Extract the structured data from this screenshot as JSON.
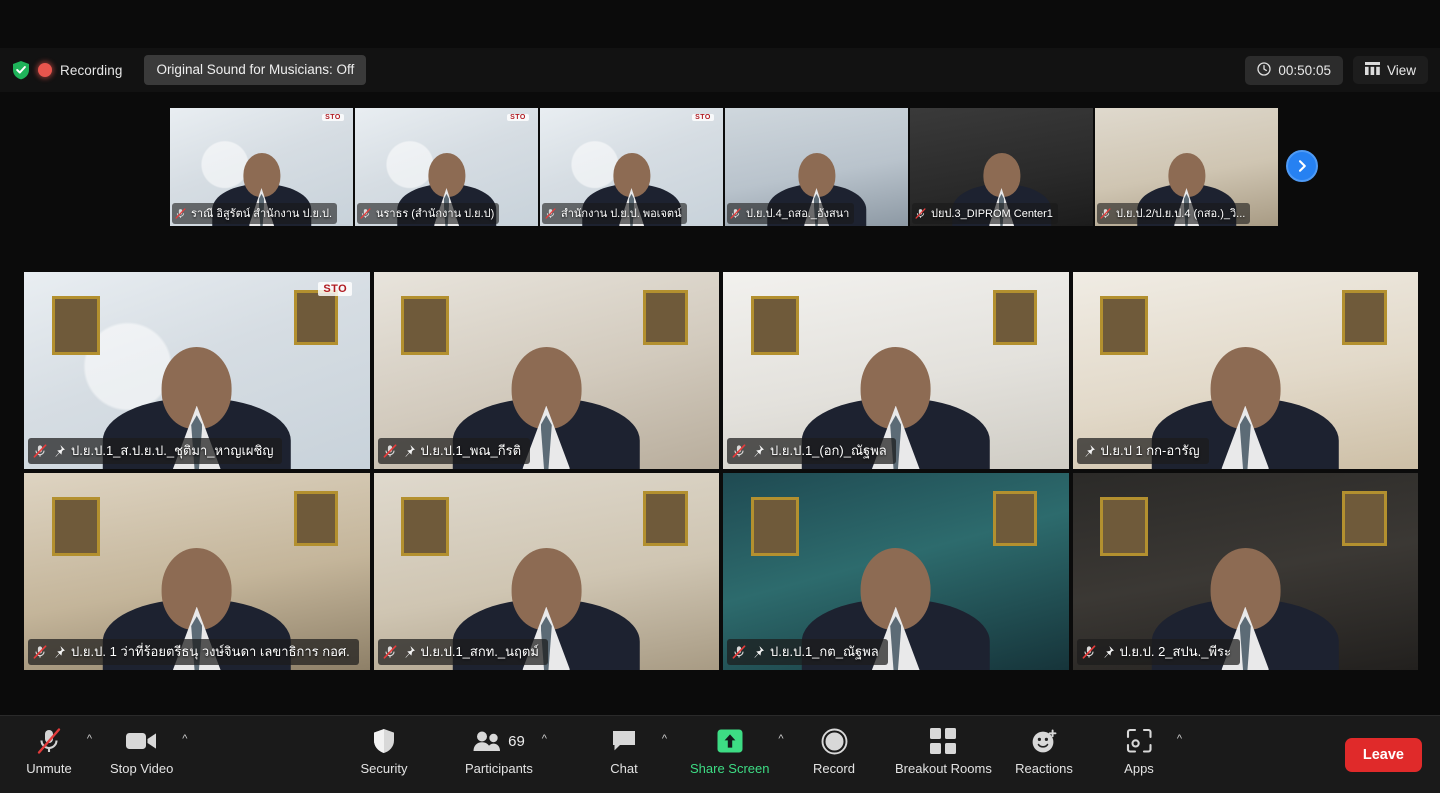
{
  "app": {
    "name": "Zoom Meeting"
  },
  "header": {
    "security_shield_icon": "shield-check-icon",
    "recording_icon": "recording-dot-icon",
    "recording_label": "Recording",
    "original_sound_label": "Original Sound for Musicians: Off",
    "timer_icon": "clock-icon",
    "timer_value": "00:50:05",
    "view_icon": "grid-view-icon",
    "view_label": "View"
  },
  "filmstrip": {
    "next_arrow_icon": "chevron-right-icon",
    "thumbnails": [
      {
        "name": "ราณี อิสูรัตน์ สำนักงาน ป.ย.ป.",
        "muted": true,
        "pinned": false,
        "bg": "bg-sto",
        "logo": "STO"
      },
      {
        "name": "นราธร (สำนักงาน ป.ย.ป)",
        "muted": true,
        "pinned": false,
        "bg": "bg-sto",
        "logo": "STO"
      },
      {
        "name": "สำนักงาน ป.ย.ป. พอเจตน์",
        "muted": true,
        "pinned": false,
        "bg": "bg-sto",
        "logo": "STO"
      },
      {
        "name": "ป.ย.ป.4_ถสอ._อังสนา",
        "muted": true,
        "pinned": false,
        "bg": "bg-bluish",
        "logo": ""
      },
      {
        "name": "ปยป.3_DIPROM Center1",
        "muted": true,
        "pinned": false,
        "bg": "bg-gray",
        "logo": ""
      },
      {
        "name": "ป.ย.ป.2/ป.ย.ป.4 (กสอ.)_วิ...",
        "muted": true,
        "pinned": false,
        "bg": "bg-office",
        "logo": ""
      }
    ]
  },
  "gallery": {
    "tiles": [
      {
        "name": "ป.ย.ป.1_ส.ป.ย.ป._ชุติมา_หาญเผชิญ",
        "muted": true,
        "pinned": true,
        "active": false,
        "bg": "bg-sto",
        "logo": "STO"
      },
      {
        "name": "ป.ย.ป.1_พณ_กีรติ",
        "muted": true,
        "pinned": true,
        "active": false,
        "bg": "bg-room-a",
        "logo": ""
      },
      {
        "name": "ป.ย.ป.1_(อก)_ณัฐพล",
        "muted": true,
        "pinned": true,
        "active": false,
        "bg": "bg-white",
        "logo": ""
      },
      {
        "name": "ป.ย.ป 1 กก-อารัญ",
        "muted": false,
        "pinned": true,
        "active": true,
        "bg": "bg-room-c",
        "logo": ""
      },
      {
        "name": "ป.ย.ป. 1 ว่าที่ร้อยตรีธนุ วงษ์จินดา เลขาธิการ กอศ.",
        "muted": true,
        "pinned": true,
        "active": false,
        "bg": "bg-warm",
        "logo": ""
      },
      {
        "name": "ป.ย.ป.1_สกท._นฤตม์",
        "muted": true,
        "pinned": true,
        "active": false,
        "bg": "bg-office",
        "logo": ""
      },
      {
        "name": "ป.ย.ป.1_กต_ณัฐพล",
        "muted": true,
        "pinned": true,
        "active": false,
        "bg": "bg-teal",
        "logo": ""
      },
      {
        "name": "ป.ย.ป. 2_สปน._พีระ",
        "muted": true,
        "pinned": true,
        "active": false,
        "bg": "bg-dark-a",
        "logo": ""
      }
    ]
  },
  "toolbar": {
    "items": [
      {
        "id": "mute",
        "icon": "microphone-muted-icon",
        "label": "Unmute",
        "caret": true,
        "green": false,
        "count": ""
      },
      {
        "id": "video",
        "icon": "video-camera-icon",
        "label": "Stop Video",
        "caret": true,
        "green": false,
        "count": ""
      },
      {
        "id": "security",
        "icon": "shield-icon",
        "label": "Security",
        "caret": false,
        "green": false,
        "count": ""
      },
      {
        "id": "participants",
        "icon": "people-icon",
        "label": "Participants",
        "caret": true,
        "green": false,
        "count": "69"
      },
      {
        "id": "chat",
        "icon": "chat-bubble-icon",
        "label": "Chat",
        "caret": true,
        "green": false,
        "count": ""
      },
      {
        "id": "share",
        "icon": "share-screen-icon",
        "label": "Share Screen",
        "caret": true,
        "green": true,
        "count": ""
      },
      {
        "id": "record",
        "icon": "record-circle-icon",
        "label": "Record",
        "caret": false,
        "green": false,
        "count": ""
      },
      {
        "id": "breakout",
        "icon": "breakout-rooms-icon",
        "label": "Breakout Rooms",
        "caret": false,
        "green": false,
        "count": ""
      },
      {
        "id": "reactions",
        "icon": "reactions-smiley-icon",
        "label": "Reactions",
        "caret": false,
        "green": false,
        "count": ""
      },
      {
        "id": "apps",
        "icon": "apps-icon",
        "label": "Apps",
        "caret": true,
        "green": false,
        "count": ""
      }
    ],
    "leave_label": "Leave"
  },
  "colors": {
    "accent_blue": "#2681f2",
    "active_speaker": "#d8f02a",
    "leave_red": "#e02a2a",
    "share_green": "#3ddc84",
    "recording_red": "#e8554d",
    "toolbar_bg": "#1a1a1a",
    "header_bg": "#121212",
    "stage_bg": "#0b0b0b"
  }
}
